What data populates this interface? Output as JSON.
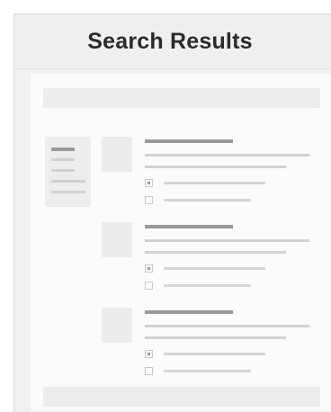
{
  "header": {
    "title": "Search Results"
  },
  "results": [
    {
      "options": [
        {
          "checked": true
        },
        {
          "checked": false
        }
      ]
    },
    {
      "options": [
        {
          "checked": true
        },
        {
          "checked": false
        }
      ]
    },
    {
      "options": [
        {
          "checked": true
        },
        {
          "checked": false
        }
      ]
    }
  ],
  "colors": {
    "header_bg": "#efefef",
    "content_bg": "#fbfbfb",
    "placeholder_dark": "#999999",
    "placeholder_light": "#d2d2d2"
  }
}
